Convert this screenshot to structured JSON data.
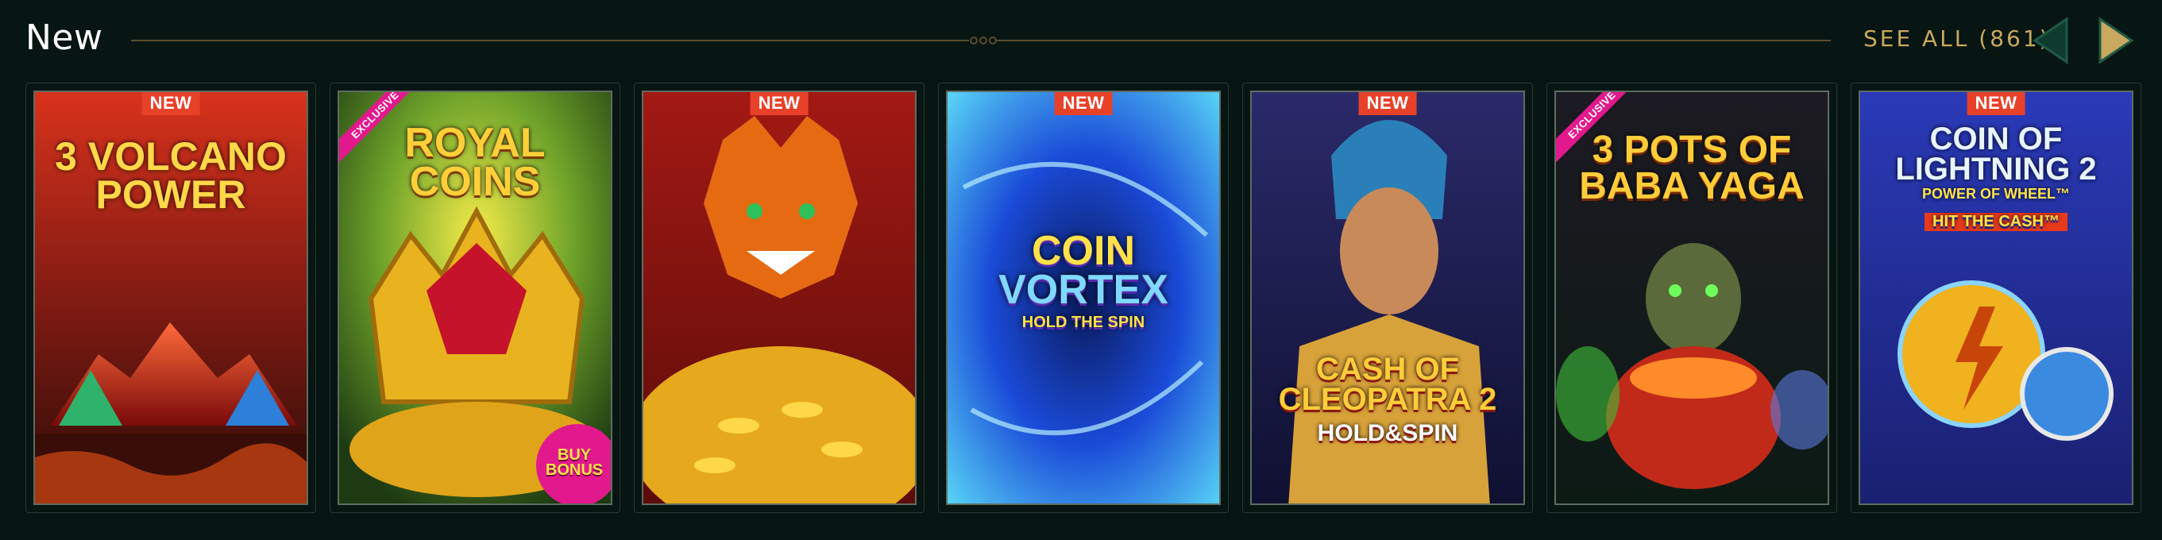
{
  "section": {
    "title": "New",
    "see_all_label": "SEE ALL (861)"
  },
  "navigation": {
    "prev_icon": "chevron-left-icon",
    "next_icon": "chevron-right-icon",
    "prev_color": "#1f5a45",
    "next_color": "#c9a85f"
  },
  "games": [
    {
      "title_line1": "3 VOLCANO",
      "title_line2": "POWER",
      "badge": "NEW"
    },
    {
      "title_line1": "ROYAL",
      "title_line2": "COINS",
      "badge": "EXCLUSIVE",
      "extra_label": "BUY BONUS"
    },
    {
      "title_line1": "",
      "title_line2": "",
      "badge": "NEW"
    },
    {
      "title_line1": "COIN",
      "title_line2": "VORTEX",
      "subtitle": "HOLD THE SPIN",
      "badge": "NEW"
    },
    {
      "title_line1": "CASH OF",
      "title_line2": "CLEOPATRA 2",
      "subtitle": "HOLD&SPIN",
      "badge": "NEW"
    },
    {
      "title_line1": "3 POTS OF",
      "title_line2": "BABA YAGA",
      "badge": "EXCLUSIVE"
    },
    {
      "title_line1": "COIN OF",
      "title_line2": "LIGHTNING 2",
      "subtitle": "POWER OF WHEEL™",
      "extra_label": "HIT THE CASH™",
      "badge": "NEW"
    }
  ]
}
